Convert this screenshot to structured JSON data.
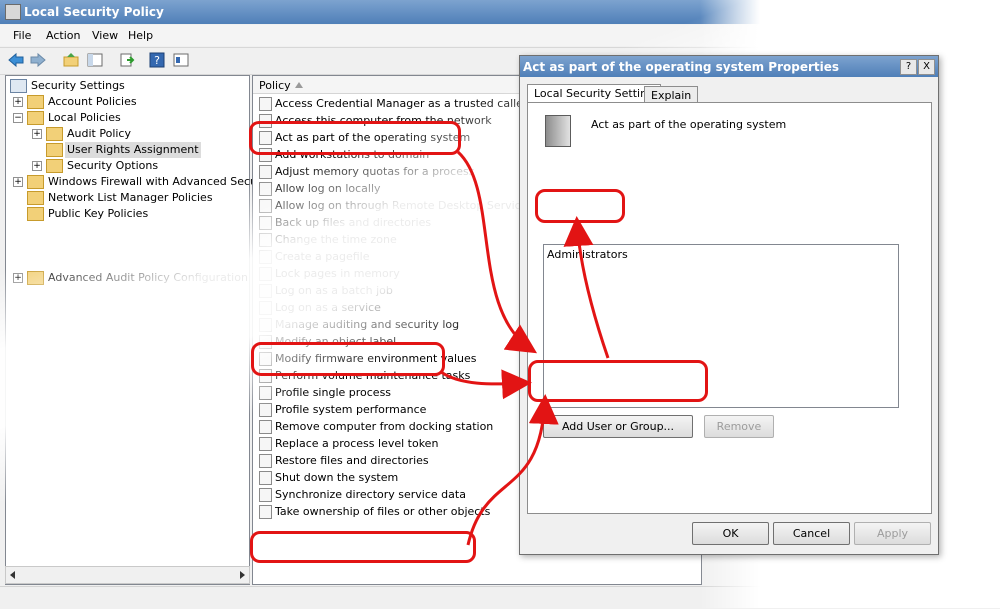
{
  "window": {
    "title": "Local Security Policy"
  },
  "menu": [
    {
      "label": "File"
    },
    {
      "label": "Action"
    },
    {
      "label": "View"
    },
    {
      "label": "Help"
    }
  ],
  "tree": [
    {
      "label": "Security Settings"
    },
    {
      "label": "Account Policies"
    },
    {
      "label": "Local Policies"
    },
    {
      "label": "Audit Policy"
    },
    {
      "label": "User Rights Assignment"
    },
    {
      "label": "Security Options"
    },
    {
      "label": "Windows Firewall with Advanced Security"
    },
    {
      "label": "Network List Manager Policies"
    },
    {
      "label": "Public Key Policies"
    },
    {
      "label": "Advanced Audit Policy Configuration"
    }
  ],
  "list": {
    "column_header": "Policy",
    "rows": [
      {
        "label": "Access Credential Manager as a trusted caller"
      },
      {
        "label": "Access this computer from the network"
      },
      {
        "label": "Act as part of the operating system"
      },
      {
        "label": "Add workstations to domain"
      },
      {
        "label": "Adjust memory quotas for a process"
      },
      {
        "label": "Allow log on locally"
      },
      {
        "label": "Allow log on through Remote Desktop Services"
      },
      {
        "label": "Back up files and directories"
      },
      {
        "label": "Change the time zone"
      },
      {
        "label": "Create a pagefile"
      },
      {
        "label": "Lock pages in memory"
      },
      {
        "label": "Log on as a batch job"
      },
      {
        "label": "Log on as a service"
      },
      {
        "label": "Manage auditing and security log"
      },
      {
        "label": "Modify an object label"
      },
      {
        "label": "Modify firmware environment values"
      },
      {
        "label": "Perform volume maintenance tasks"
      },
      {
        "label": "Profile single process"
      },
      {
        "label": "Profile system performance"
      },
      {
        "label": "Remove computer from docking station"
      },
      {
        "label": "Replace a process level token"
      },
      {
        "label": "Restore files and directories"
      },
      {
        "label": "Shut down the system"
      },
      {
        "label": "Synchronize directory service data"
      },
      {
        "label": "Take ownership of files or other objects"
      }
    ]
  },
  "dialog": {
    "title": "Act as part of the operating system Properties",
    "help_button": "?",
    "close_button": "X",
    "tabs": [
      {
        "label": "Local Security Setting"
      },
      {
        "label": "Explain"
      }
    ],
    "policy_name": "Act as part of the operating system",
    "accounts": [
      "Administrators"
    ],
    "add_button": "Add User or Group...",
    "remove_button": "Remove",
    "ok": "OK",
    "cancel": "Cancel",
    "apply": "Apply"
  },
  "colors": {
    "callout": "#e21414",
    "titlebar": "#4f7fb8"
  }
}
